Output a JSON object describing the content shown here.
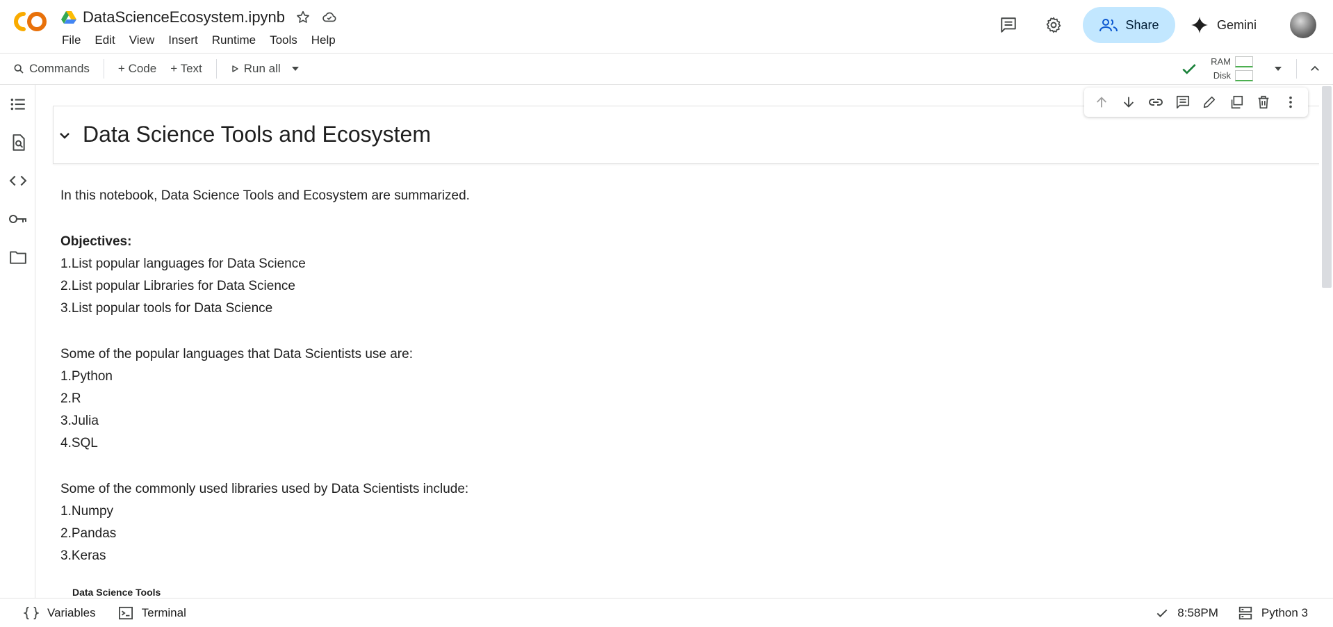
{
  "header": {
    "notebook_title": "DataScienceEcosystem.ipynb",
    "menu": [
      "File",
      "Edit",
      "View",
      "Insert",
      "Runtime",
      "Tools",
      "Help"
    ],
    "share_label": "Share",
    "gemini_label": "Gemini"
  },
  "toolbar": {
    "commands_label": "Commands",
    "code_label": "+ Code",
    "text_label": "+ Text",
    "run_all_label": "Run all",
    "ram_label": "RAM",
    "disk_label": "Disk"
  },
  "cell": {
    "heading": "Data Science Tools and Ecosystem"
  },
  "markdown": {
    "intro": "In this notebook, Data Science Tools and Ecosystem are summarized.",
    "objectives_heading": "Objectives:",
    "objectives": [
      "1.List popular languages for Data Science",
      "2.List popular Libraries for Data Science",
      "3.List popular tools for Data Science"
    ],
    "languages_intro": "Some of the popular languages that Data Scientists use are:",
    "languages": [
      "1.Python",
      "2.R",
      "3.Julia",
      "4.SQL"
    ],
    "libraries_intro": "Some of the commonly used libraries used by Data Scientists include:",
    "libraries": [
      "1.Numpy",
      "2.Pandas",
      "3.Keras"
    ],
    "tools_heading": "Data Science Tools"
  },
  "statusbar": {
    "variables_label": "Variables",
    "terminal_label": "Terminal",
    "time": "8:58PM",
    "kernel": "Python 3"
  },
  "colors": {
    "share_bg": "#c2e7ff",
    "logo_orange": "#f9ab00",
    "logo_dark_orange": "#e8710a",
    "check_green": "#188038"
  }
}
